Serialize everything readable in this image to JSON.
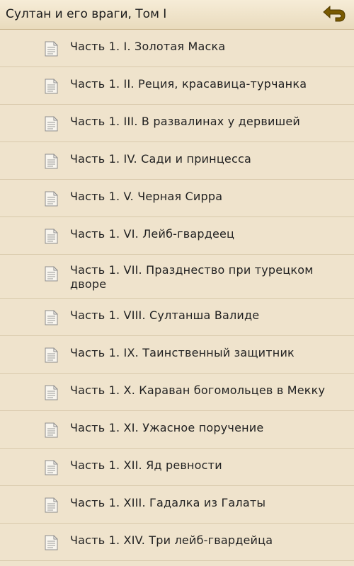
{
  "header": {
    "title": "Султан и его враги, Том I",
    "back_icon": "back-arrow-icon",
    "accent": "#7a5a00"
  },
  "chapters": [
    {
      "label": "Часть 1. I. Золотая Маска"
    },
    {
      "label": "Часть 1. II. Реция, красавица-турчанка"
    },
    {
      "label": "Часть 1. III. В развалинах у дервишей"
    },
    {
      "label": "Часть 1. IV. Сади и принцесса"
    },
    {
      "label": "Часть 1. V. Черная Сирра"
    },
    {
      "label": "Часть 1. VI. Лейб-гвардеец"
    },
    {
      "label": "Часть 1. VII. Празднество при турецком дворе"
    },
    {
      "label": "Часть 1. VIII. Султанша Валиде"
    },
    {
      "label": "Часть 1. IX. Таинственный защитник"
    },
    {
      "label": "Часть 1. X. Караван богомольцев в Мекку"
    },
    {
      "label": "Часть 1. XI. Ужасное поручение"
    },
    {
      "label": "Часть 1. XII. Яд ревности"
    },
    {
      "label": "Часть 1. XIII. Гадалка из Галаты"
    },
    {
      "label": "Часть 1. XIV. Три лейб-гвардейца"
    }
  ],
  "item_icon": "document-icon"
}
